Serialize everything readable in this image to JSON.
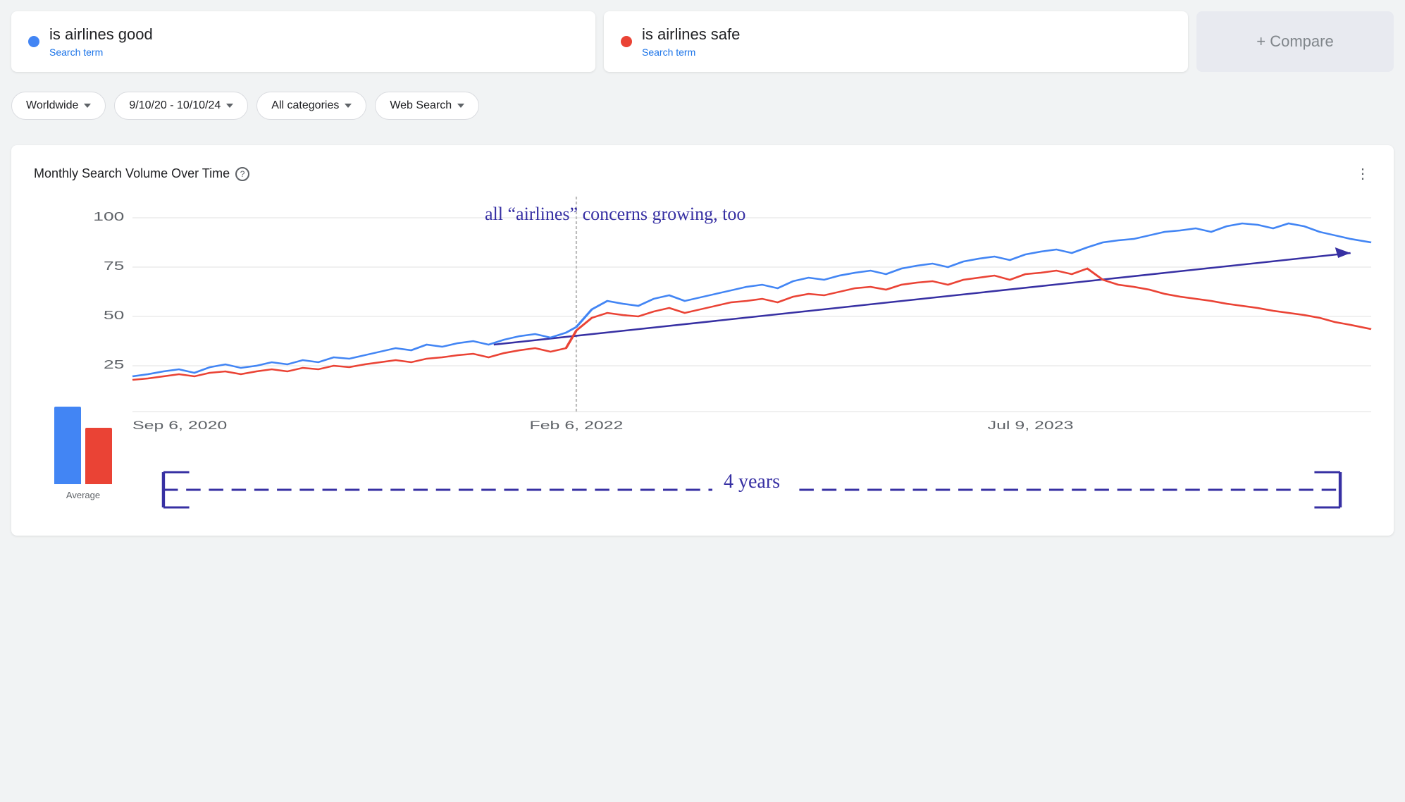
{
  "search_terms": [
    {
      "id": "term1",
      "name": "is airlines good",
      "label": "Search term",
      "dot_color": "#4285f4"
    },
    {
      "id": "term2",
      "name": "is airlines safe",
      "label": "Search term",
      "dot_color": "#ea4335"
    }
  ],
  "compare_label": "+ Compare",
  "filters": {
    "location": "Worldwide",
    "date_range": "9/10/20 - 10/10/24",
    "category": "All categories",
    "search_type": "Web Search"
  },
  "chart": {
    "title": "Monthly Search Volume Over Time",
    "help_icon": "?",
    "more_icon": "⋮",
    "y_axis_labels": [
      "100",
      "75",
      "50",
      "25"
    ],
    "x_axis_labels": [
      "Sep 6, 2020",
      "Feb 6, 2022",
      "Jul 9, 2023"
    ],
    "avg_label": "Average",
    "avg_bar_blue_height": 110,
    "avg_bar_red_height": 80
  },
  "annotations": {
    "trend_text": "all “airlines” concerns growing, too",
    "years_text": "4 years"
  },
  "colors": {
    "blue": "#4285f4",
    "red": "#ea4335",
    "annotation_purple": "#3730a3",
    "trend_line": "#5c6bc0"
  }
}
